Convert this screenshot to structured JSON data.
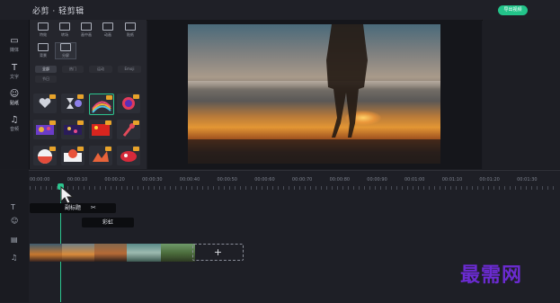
{
  "app": {
    "title": "必剪 · 轻剪辑",
    "export_label": "导出视频"
  },
  "nav": [
    {
      "label": "媒体",
      "icon": "folder-icon"
    },
    {
      "label": "文字",
      "icon": "text-icon"
    },
    {
      "label": "贴纸",
      "icon": "sticker-icon"
    },
    {
      "label": "音频",
      "icon": "music-icon"
    }
  ],
  "panel": {
    "categories": [
      "特效",
      "转场",
      "画中画",
      "动画",
      "贴纸",
      "背景",
      "分屏"
    ],
    "subtabs": [
      "全部",
      "热门",
      "运动",
      "Emoji",
      "节日",
      "新年"
    ],
    "stickers_count": 12
  },
  "timeline": {
    "ticks": [
      "00:00:00",
      "00:00:10",
      "00:00:20",
      "00:00:30",
      "00:00:40",
      "00:00:50",
      "00:00:60",
      "00:00:70",
      "00:00:80",
      "00:00:90",
      "00:01:00",
      "00:01:10",
      "00:01:20",
      "00:01:30"
    ],
    "clips": [
      {
        "label": "副标题"
      },
      {
        "label": "彩虹"
      }
    ],
    "add_label": "+"
  },
  "watermark": "最需网"
}
